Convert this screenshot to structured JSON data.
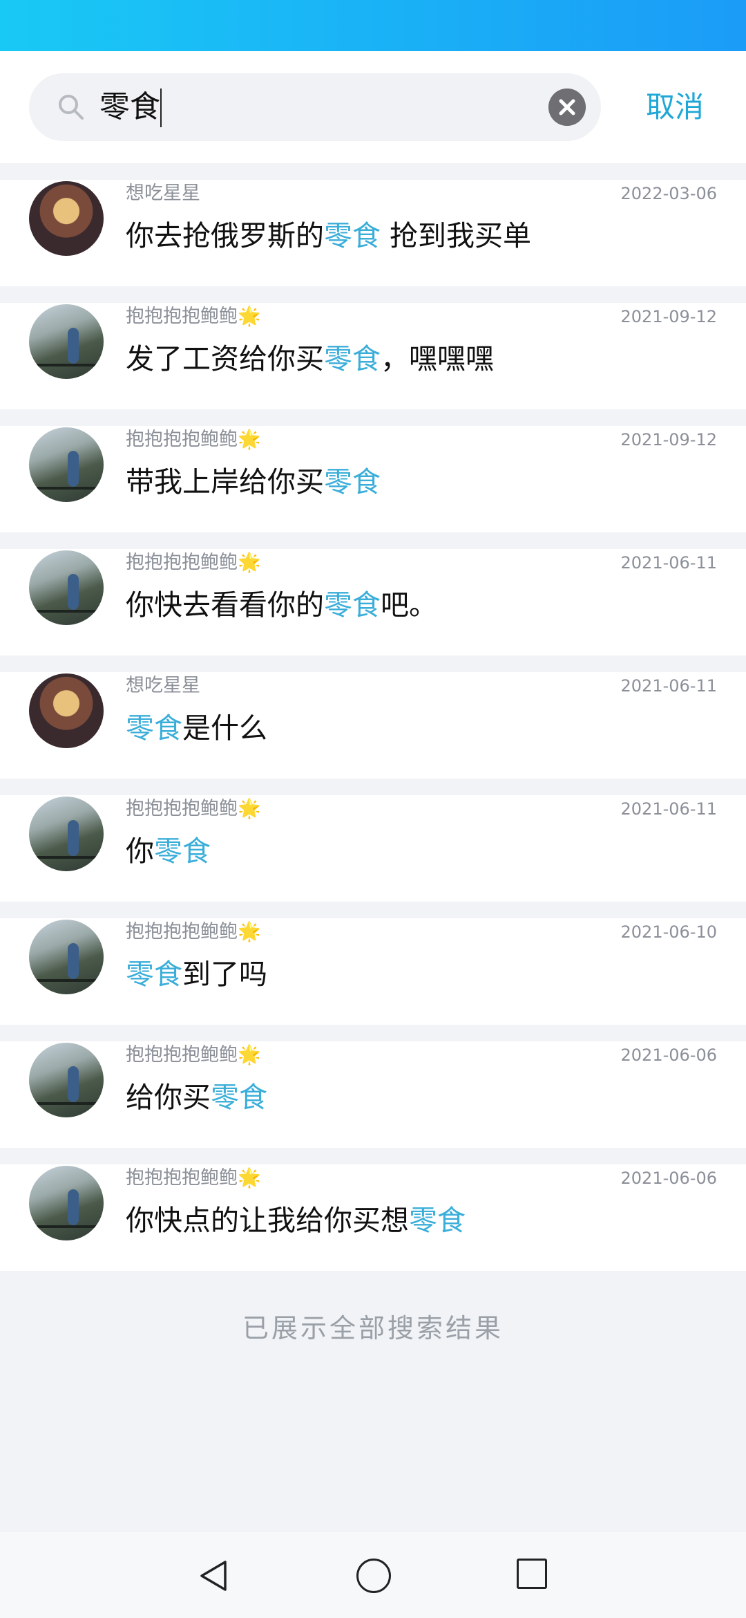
{
  "search": {
    "query": "零食",
    "cancel_label": "取消"
  },
  "results": [
    {
      "sender": "想吃星星",
      "star": "",
      "date": "2022-03-06",
      "avatar": "cat",
      "pre": "你去抢俄罗斯的",
      "hl": "零食",
      "post": " 抢到我买单"
    },
    {
      "sender": "抱抱抱抱鲍鲍",
      "star": "🌟",
      "date": "2021-09-12",
      "avatar": "path",
      "pre": "发了工资给你买",
      "hl": "零食",
      "post": "，嘿嘿嘿"
    },
    {
      "sender": "抱抱抱抱鲍鲍",
      "star": "🌟",
      "date": "2021-09-12",
      "avatar": "path",
      "pre": "带我上岸给你买",
      "hl": "零食",
      "post": ""
    },
    {
      "sender": "抱抱抱抱鲍鲍",
      "star": "🌟",
      "date": "2021-06-11",
      "avatar": "path",
      "pre": "你快去看看你的",
      "hl": "零食",
      "post": "吧。"
    },
    {
      "sender": "想吃星星",
      "star": "",
      "date": "2021-06-11",
      "avatar": "cat",
      "pre": "",
      "hl": "零食",
      "post": "是什么"
    },
    {
      "sender": "抱抱抱抱鲍鲍",
      "star": "🌟",
      "date": "2021-06-11",
      "avatar": "path",
      "pre": "你",
      "hl": "零食",
      "post": ""
    },
    {
      "sender": "抱抱抱抱鲍鲍",
      "star": "🌟",
      "date": "2021-06-10",
      "avatar": "path",
      "pre": "",
      "hl": "零食",
      "post": "到了吗"
    },
    {
      "sender": "抱抱抱抱鲍鲍",
      "star": "🌟",
      "date": "2021-06-06",
      "avatar": "path",
      "pre": "给你买",
      "hl": "零食",
      "post": ""
    },
    {
      "sender": "抱抱抱抱鲍鲍",
      "star": "🌟",
      "date": "2021-06-06",
      "avatar": "path",
      "pre": "你快点的让我给你买想",
      "hl": "零食",
      "post": ""
    }
  ],
  "end_message": "已展示全部搜索结果",
  "colors": {
    "accent": "#3aaed9",
    "cancel": "#1fa7d6",
    "status_bar_start": "#19c9f5",
    "status_bar_end": "#1b9cf7"
  },
  "icons": {
    "search": "search-icon",
    "clear": "clear-icon",
    "nav_back": "back-triangle-icon",
    "nav_home": "home-circle-icon",
    "nav_recent": "recent-square-icon"
  }
}
